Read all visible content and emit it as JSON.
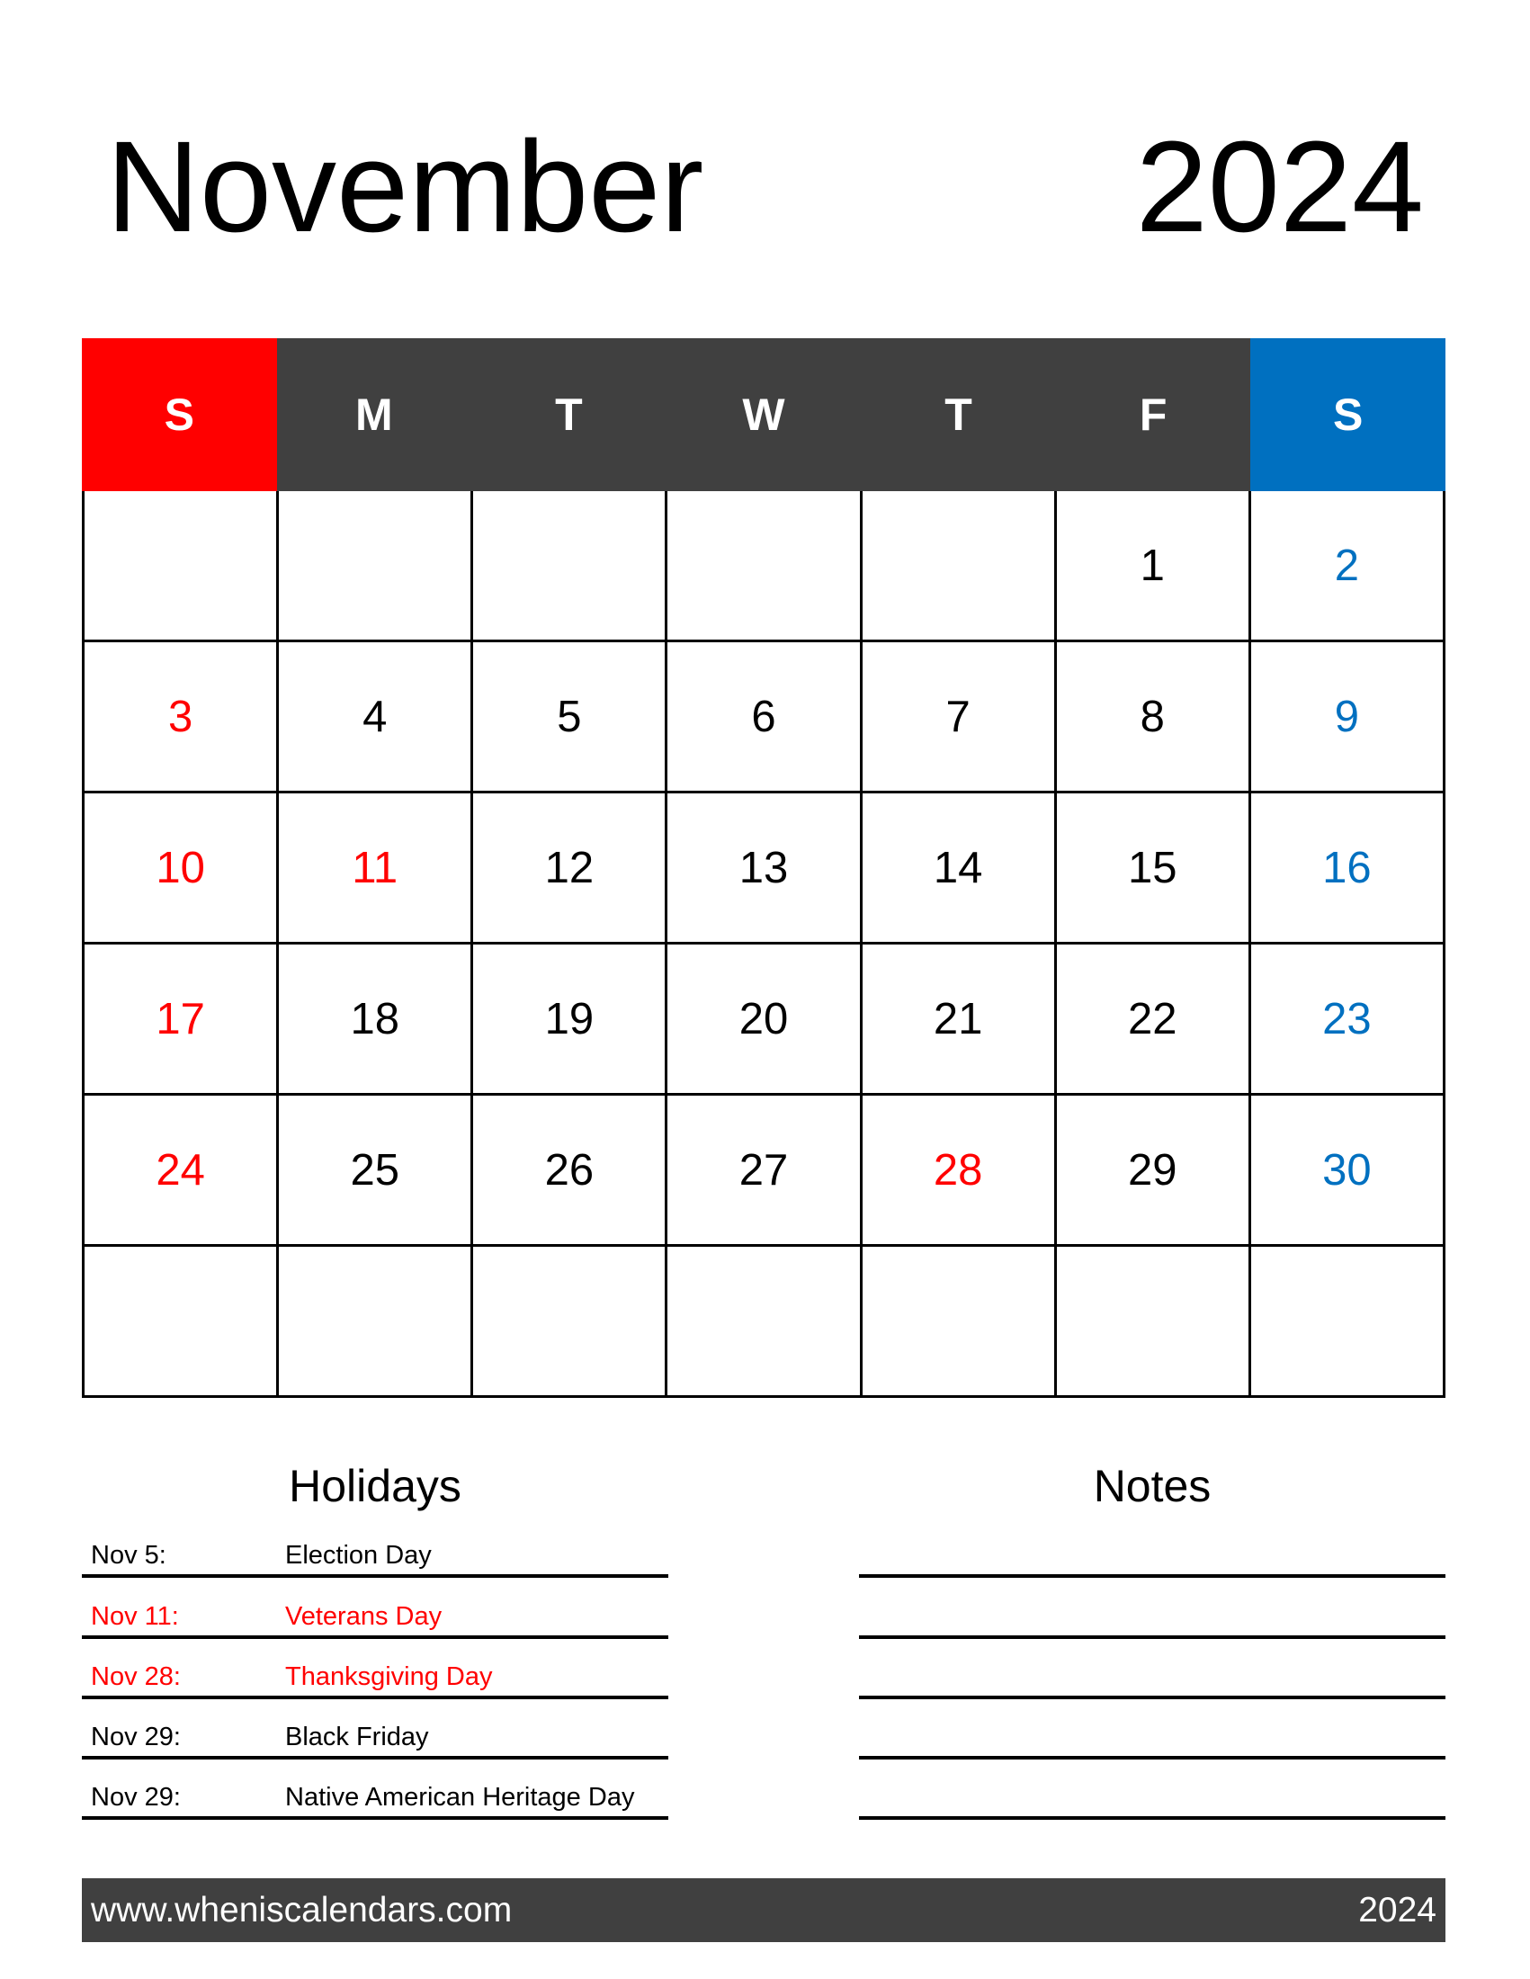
{
  "header": {
    "month": "November",
    "year": "2024"
  },
  "colors": {
    "sunday": "#ff0000",
    "weekday_header": "#404040",
    "saturday": "#0070c0",
    "holiday": "#ff0000",
    "default_text": "#000000"
  },
  "weekdays": [
    {
      "label": "S",
      "kind": "sunday"
    },
    {
      "label": "M",
      "kind": "weekday"
    },
    {
      "label": "T",
      "kind": "weekday"
    },
    {
      "label": "W",
      "kind": "weekday"
    },
    {
      "label": "T",
      "kind": "weekday"
    },
    {
      "label": "F",
      "kind": "weekday"
    },
    {
      "label": "S",
      "kind": "saturday"
    }
  ],
  "weeks": [
    [
      {
        "d": ""
      },
      {
        "d": ""
      },
      {
        "d": ""
      },
      {
        "d": ""
      },
      {
        "d": ""
      },
      {
        "d": "1"
      },
      {
        "d": "2",
        "c": "blue"
      }
    ],
    [
      {
        "d": "3",
        "c": "red"
      },
      {
        "d": "4"
      },
      {
        "d": "5"
      },
      {
        "d": "6"
      },
      {
        "d": "7"
      },
      {
        "d": "8"
      },
      {
        "d": "9",
        "c": "blue"
      }
    ],
    [
      {
        "d": "10",
        "c": "red"
      },
      {
        "d": "11",
        "c": "red"
      },
      {
        "d": "12"
      },
      {
        "d": "13"
      },
      {
        "d": "14"
      },
      {
        "d": "15"
      },
      {
        "d": "16",
        "c": "blue"
      }
    ],
    [
      {
        "d": "17",
        "c": "red"
      },
      {
        "d": "18"
      },
      {
        "d": "19"
      },
      {
        "d": "20"
      },
      {
        "d": "21"
      },
      {
        "d": "22"
      },
      {
        "d": "23",
        "c": "blue"
      }
    ],
    [
      {
        "d": "24",
        "c": "red"
      },
      {
        "d": "25"
      },
      {
        "d": "26"
      },
      {
        "d": "27"
      },
      {
        "d": "28",
        "c": "red"
      },
      {
        "d": "29"
      },
      {
        "d": "30",
        "c": "blue"
      }
    ],
    [
      {
        "d": ""
      },
      {
        "d": ""
      },
      {
        "d": ""
      },
      {
        "d": ""
      },
      {
        "d": ""
      },
      {
        "d": ""
      },
      {
        "d": ""
      }
    ]
  ],
  "holidays": {
    "title": "Holidays",
    "items": [
      {
        "date": "Nov 5:",
        "name": "Election Day",
        "highlight": false
      },
      {
        "date": "Nov 11:",
        "name": "Veterans Day",
        "highlight": true
      },
      {
        "date": "Nov 28:",
        "name": "Thanksgiving Day",
        "highlight": true
      },
      {
        "date": "Nov 29:",
        "name": "Black Friday",
        "highlight": false
      },
      {
        "date": "Nov 29:",
        "name": "Native American Heritage Day",
        "highlight": false
      }
    ]
  },
  "notes": {
    "title": "Notes",
    "line_count": 5
  },
  "footer": {
    "website": "www.wheniscalendars.com",
    "year": "2024"
  }
}
